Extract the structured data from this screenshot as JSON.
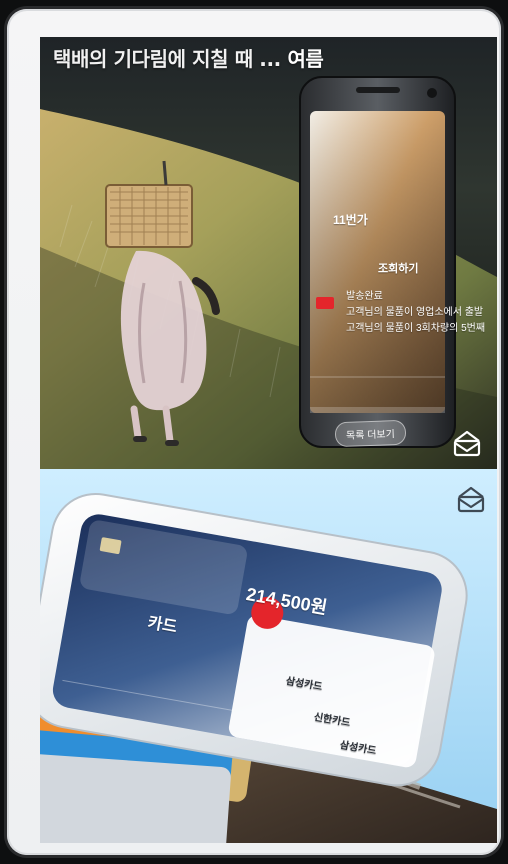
{
  "top_banner": {
    "title_main": "택배의 기다림에 지칠 때 ...",
    "title_accent": "여름",
    "app_badge": "11번가",
    "track_button": "조회하기",
    "line1": "발송완료",
    "line2": "고객님의 물품이 영업소에서 출발",
    "line3": "고객님의 물품이 3회차량의 5번째",
    "footer_button": "목록 더보기"
  },
  "bottom_banner": {
    "card_label": "카드",
    "amount": "214,500원",
    "card_name_1": "삼성카드",
    "card_name_2": "신한카드",
    "card_name_3": "삼성카드"
  },
  "icons": {
    "mail_top": "mail-icon",
    "mail_bottom": "mail-icon"
  },
  "colors": {
    "accent_red": "#e4252b"
  }
}
